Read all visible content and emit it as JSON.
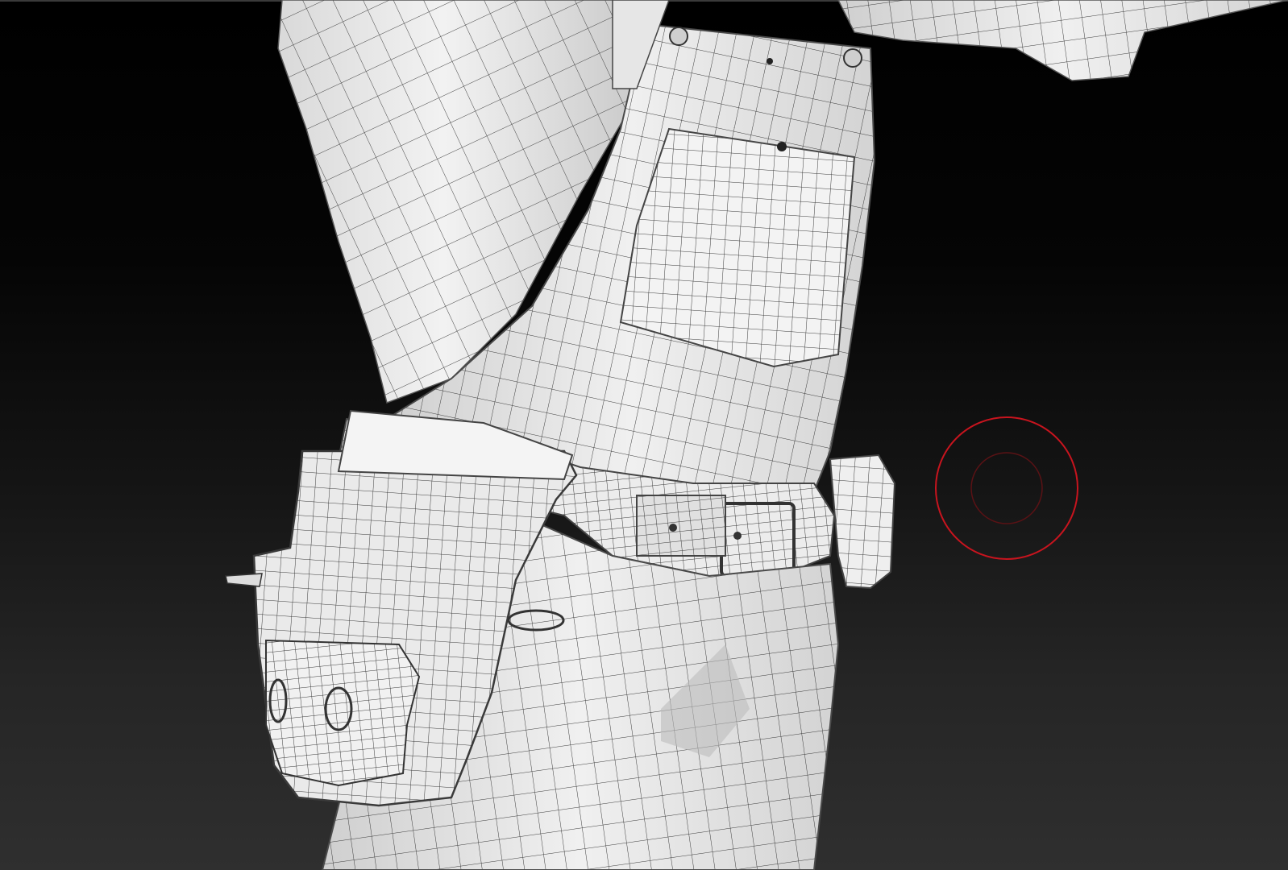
{
  "viewport": {
    "background_top": "#000000",
    "background_bottom": "#2f2f2f",
    "mesh_fill": "#eeeeee",
    "mesh_shade": "#cfcfcf",
    "wire_color": "#3c3c3c",
    "brush_color": "#c8141e"
  },
  "canvas": {
    "brush_cursor_icon": "brush-draw-size-ring-icon"
  }
}
